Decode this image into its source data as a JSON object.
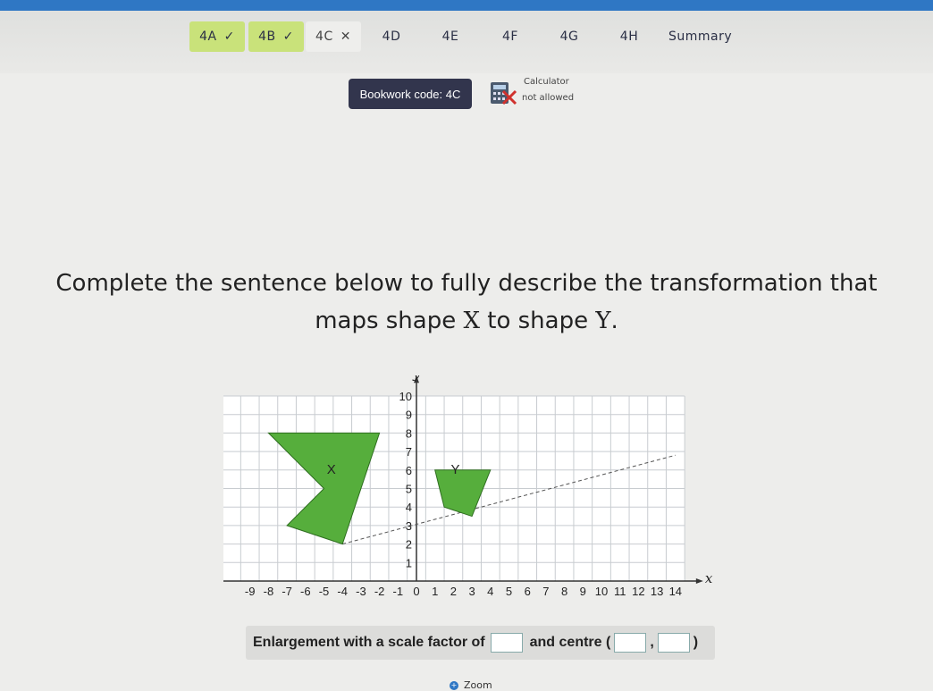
{
  "tabs": [
    {
      "label": "4A",
      "mark": "✓",
      "state": "done"
    },
    {
      "label": "4B",
      "mark": "✓",
      "state": "done"
    },
    {
      "label": "4C",
      "mark": "✕",
      "state": "wrong"
    },
    {
      "label": "4D",
      "mark": "",
      "state": "todo"
    },
    {
      "label": "4E",
      "mark": "",
      "state": "todo"
    },
    {
      "label": "4F",
      "mark": "",
      "state": "todo"
    },
    {
      "label": "4G",
      "mark": "",
      "state": "todo"
    },
    {
      "label": "4H",
      "mark": "",
      "state": "todo"
    },
    {
      "label": "Summary",
      "mark": "",
      "state": "todo"
    }
  ],
  "bookwork": {
    "label": "Bookwork code: 4C"
  },
  "calculator": {
    "line1": "Calculator",
    "line2": "not allowed",
    "icon": "calculator-crossed-icon"
  },
  "question": {
    "line1": "Complete the sentence below to fully describe the transformation that",
    "line2_prefix": "maps shape ",
    "shape_x": "X",
    "line2_middle": " to shape ",
    "shape_y": "Y",
    "line2_suffix": "."
  },
  "graph": {
    "x_label": "x",
    "y_label": "y",
    "x_ticks": [
      "-9",
      "-8",
      "-7",
      "-6",
      "-5",
      "-4",
      "-3",
      "-2",
      "-1",
      "0",
      "1",
      "2",
      "3",
      "4",
      "5",
      "6",
      "7",
      "8",
      "9",
      "10",
      "11",
      "12",
      "13",
      "14"
    ],
    "y_ticks": [
      "1",
      "2",
      "3",
      "4",
      "5",
      "6",
      "7",
      "8",
      "9",
      "10"
    ],
    "shape_x_label": "X",
    "shape_y_label": "Y",
    "shape_color": "#56ae3c",
    "shape_x_vertices": [
      [
        -8,
        8
      ],
      [
        -2,
        8
      ],
      [
        -4,
        2
      ],
      [
        -7,
        3
      ],
      [
        -5,
        5
      ]
    ],
    "shape_y_vertices": [
      [
        1,
        6
      ],
      [
        4,
        6
      ],
      [
        3,
        3.5
      ],
      [
        1.5,
        4
      ]
    ],
    "ray": [
      [
        -4,
        2
      ],
      [
        14,
        6.8
      ]
    ]
  },
  "answer": {
    "prefix": "Enlargement with a scale factor of",
    "middle": "and centre (",
    "comma": ",",
    "suffix": ")"
  },
  "zoom": {
    "label": "Zoom",
    "icon": "zoom-icon"
  }
}
